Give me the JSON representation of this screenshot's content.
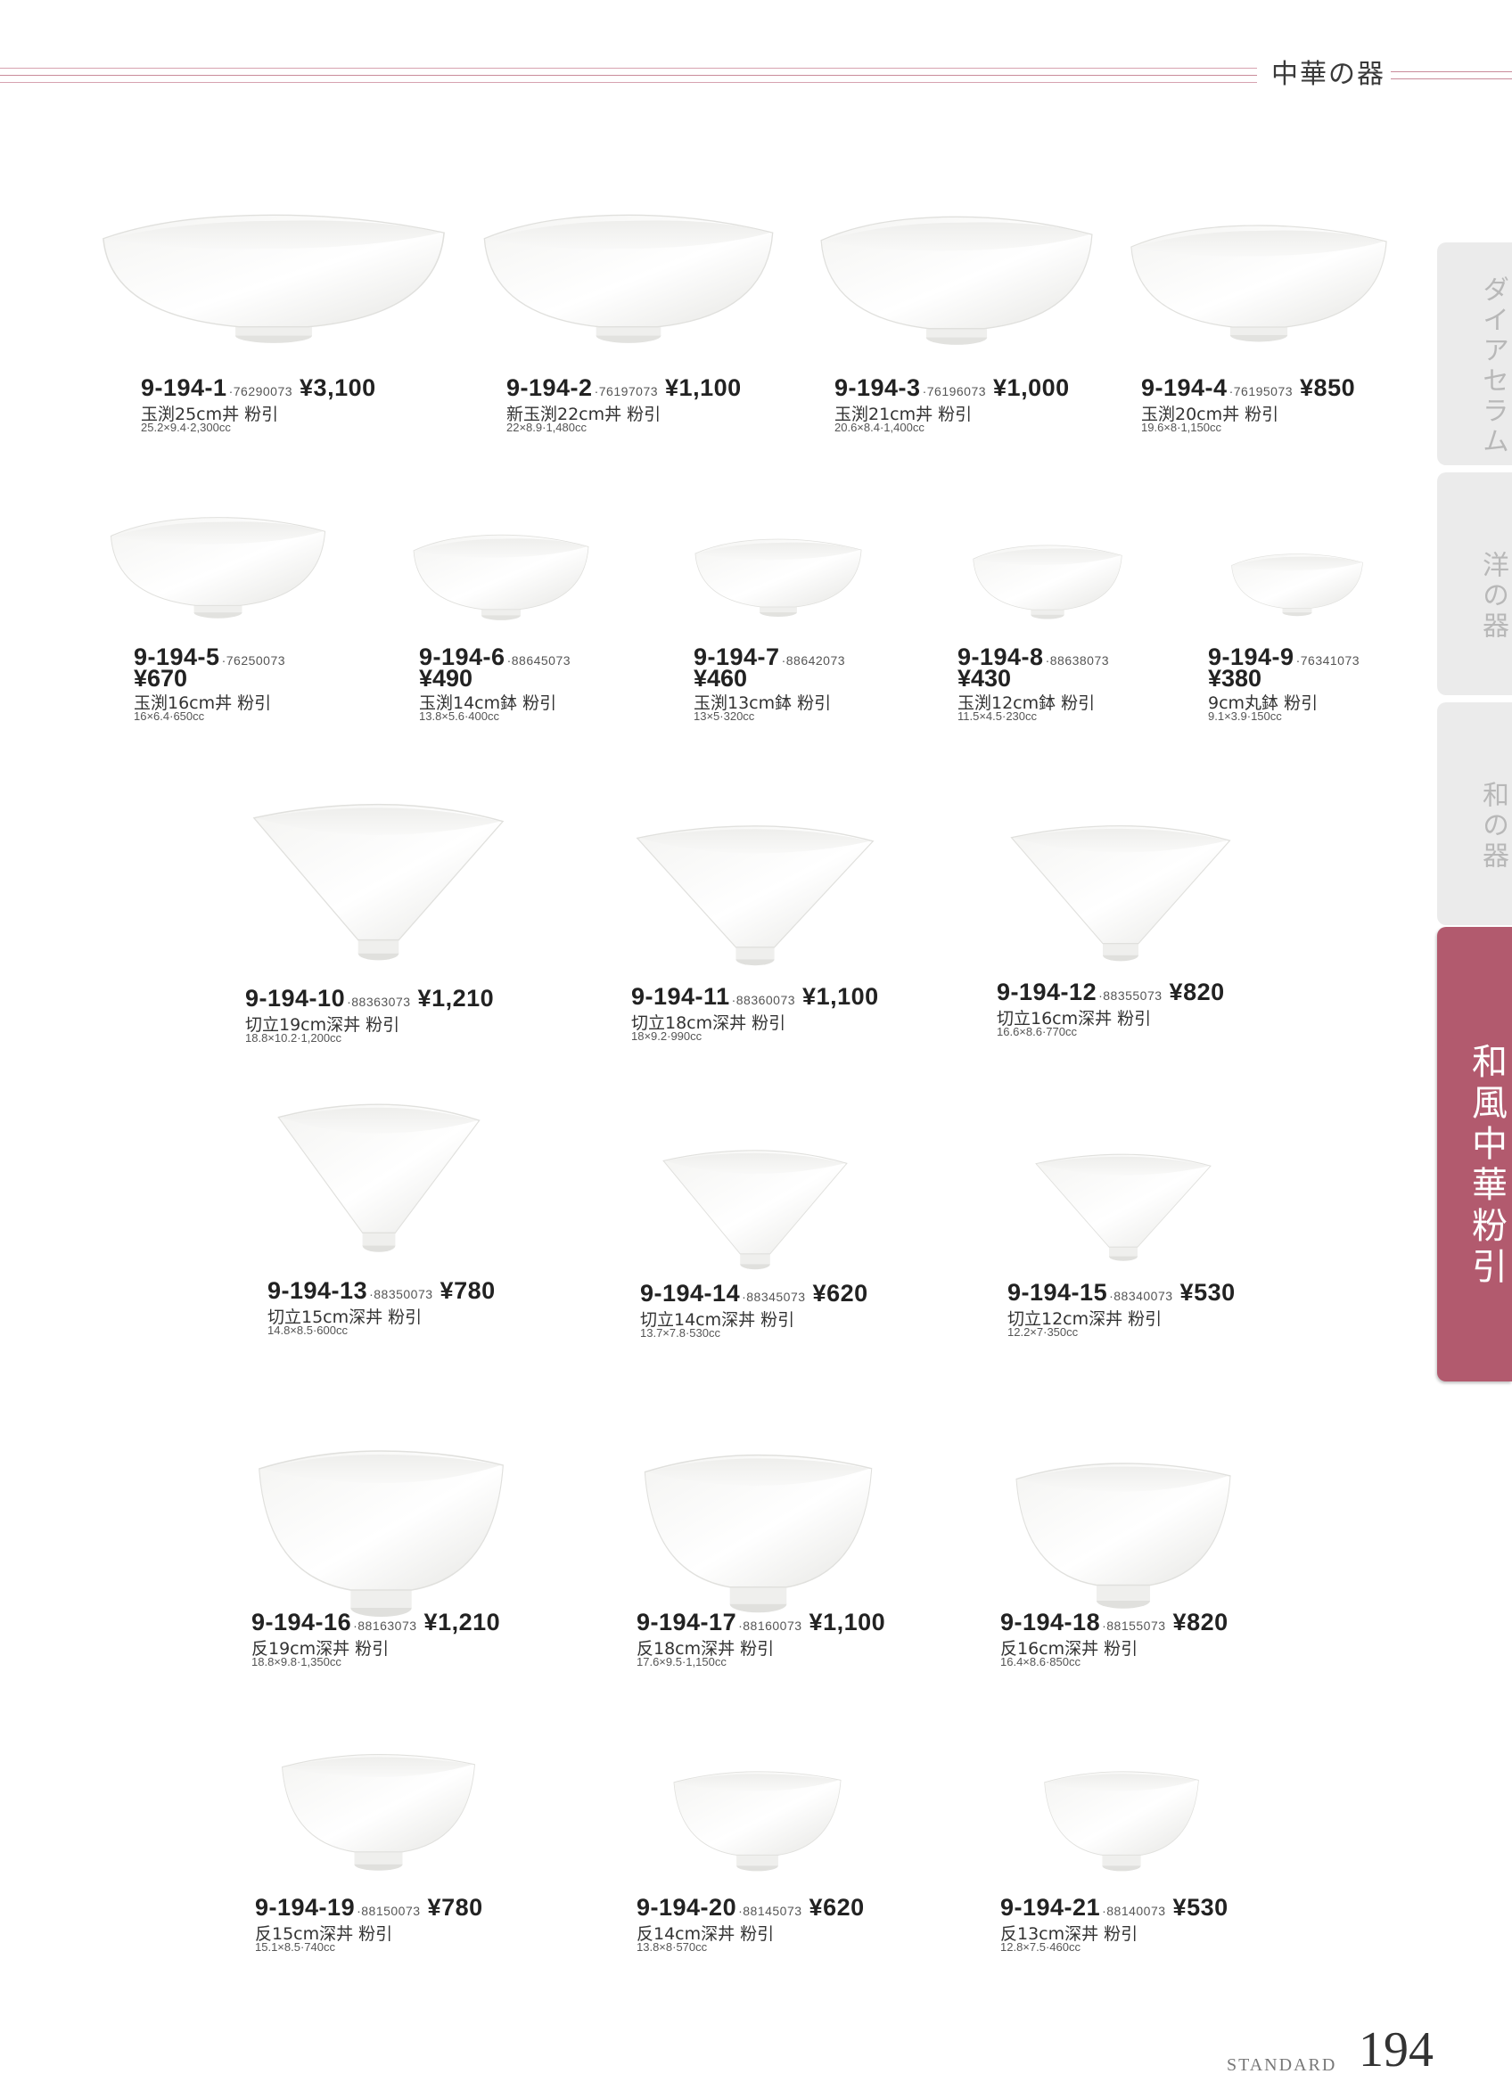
{
  "header": {
    "title": "中華の器"
  },
  "side_tabs": [
    {
      "label": "ダイアセラム",
      "active": false
    },
    {
      "label": "洋の器",
      "active": false
    },
    {
      "label": "和の器",
      "active": false
    },
    {
      "label": "和風中華粉引",
      "active": true
    }
  ],
  "side_sub_label": "中華の器",
  "products": [
    {
      "code": "9-194-1",
      "jan": "76290073",
      "price": "¥3,100",
      "name": "玉渕25cm丼 粉引",
      "spec": "25.2×9.4·2,300cc"
    },
    {
      "code": "9-194-2",
      "jan": "76197073",
      "price": "¥1,100",
      "name": "新玉渕22cm丼 粉引",
      "spec": "22×8.9·1,480cc"
    },
    {
      "code": "9-194-3",
      "jan": "76196073",
      "price": "¥1,000",
      "name": "玉渕21cm丼 粉引",
      "spec": "20.6×8.4·1,400cc"
    },
    {
      "code": "9-194-4",
      "jan": "76195073",
      "price": "¥850",
      "name": "玉渕20cm丼 粉引",
      "spec": "19.6×8·1,150cc"
    },
    {
      "code": "9-194-5",
      "jan": "76250073",
      "price": "¥670",
      "name": "玉渕16cm丼 粉引",
      "spec": "16×6.4·650cc"
    },
    {
      "code": "9-194-6",
      "jan": "88645073",
      "price": "¥490",
      "name": "玉渕14cm鉢 粉引",
      "spec": "13.8×5.6·400cc"
    },
    {
      "code": "9-194-7",
      "jan": "88642073",
      "price": "¥460",
      "name": "玉渕13cm鉢 粉引",
      "spec": "13×5·320cc"
    },
    {
      "code": "9-194-8",
      "jan": "88638073",
      "price": "¥430",
      "name": "玉渕12cm鉢 粉引",
      "spec": "11.5×4.5·230cc"
    },
    {
      "code": "9-194-9",
      "jan": "76341073",
      "price": "¥380",
      "name": "9cm丸鉢 粉引",
      "spec": "9.1×3.9·150cc"
    },
    {
      "code": "9-194-10",
      "jan": "88363073",
      "price": "¥1,210",
      "name": "切立19cm深丼 粉引",
      "spec": "18.8×10.2·1,200cc"
    },
    {
      "code": "9-194-11",
      "jan": "88360073",
      "price": "¥1,100",
      "name": "切立18cm深丼 粉引",
      "spec": "18×9.2·990cc"
    },
    {
      "code": "9-194-12",
      "jan": "88355073",
      "price": "¥820",
      "name": "切立16cm深丼 粉引",
      "spec": "16.6×8.6·770cc"
    },
    {
      "code": "9-194-13",
      "jan": "88350073",
      "price": "¥780",
      "name": "切立15cm深丼 粉引",
      "spec": "14.8×8.5·600cc"
    },
    {
      "code": "9-194-14",
      "jan": "88345073",
      "price": "¥620",
      "name": "切立14cm深丼 粉引",
      "spec": "13.7×7.8·530cc"
    },
    {
      "code": "9-194-15",
      "jan": "88340073",
      "price": "¥530",
      "name": "切立12cm深丼 粉引",
      "spec": "12.2×7·350cc"
    },
    {
      "code": "9-194-16",
      "jan": "88163073",
      "price": "¥1,210",
      "name": "反19cm深丼 粉引",
      "spec": "18.8×9.8·1,350cc"
    },
    {
      "code": "9-194-17",
      "jan": "88160073",
      "price": "¥1,100",
      "name": "反18cm深丼 粉引",
      "spec": "17.6×9.5·1,150cc"
    },
    {
      "code": "9-194-18",
      "jan": "88155073",
      "price": "¥820",
      "name": "反16cm深丼 粉引",
      "spec": "16.4×8.6·850cc"
    },
    {
      "code": "9-194-19",
      "jan": "88150073",
      "price": "¥780",
      "name": "反15cm深丼 粉引",
      "spec": "15.1×8.5·740cc"
    },
    {
      "code": "9-194-20",
      "jan": "88145073",
      "price": "¥620",
      "name": "反14cm深丼 粉引",
      "spec": "13.8×8·570cc"
    },
    {
      "code": "9-194-21",
      "jan": "88140073",
      "price": "¥530",
      "name": "反13cm深丼 粉引",
      "spec": "12.8×7.5·460cc"
    }
  ],
  "footer": {
    "label": "STANDARD",
    "page": "194"
  }
}
